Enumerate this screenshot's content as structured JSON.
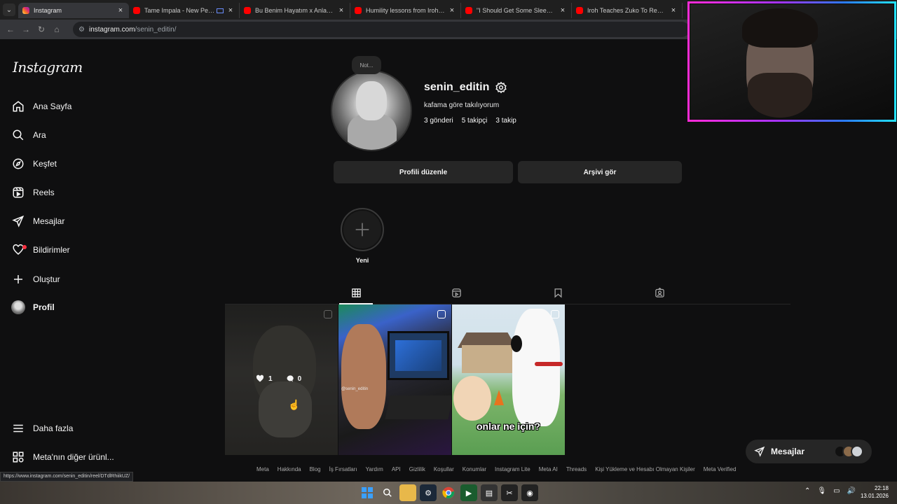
{
  "browser": {
    "tabs": [
      {
        "title": "Instagram",
        "favicon": "instagram-icon",
        "active": true
      },
      {
        "title": "Tame Impala - New Person",
        "favicon": "youtube-icon",
        "active": false
      },
      {
        "title": "Bu Benim Hayatım x Anlamazdı",
        "favicon": "youtube-icon",
        "active": false
      },
      {
        "title": "Humility lessons from Iroh - Yo",
        "favicon": "youtube-icon",
        "active": false
      },
      {
        "title": "\"I Should Get Some Sleep\" Me",
        "favicon": "youtube-icon",
        "active": false
      },
      {
        "title": "Iroh Teaches Zuko To Redirect L",
        "favicon": "youtube-icon",
        "active": false
      }
    ],
    "close_glyph": "×",
    "url_host": "instagram.com",
    "url_path": "/senin_editin/",
    "status_url": "https://www.instagram.com/senin_editin/reel/DTdlRhiikUZ/"
  },
  "sidebar": {
    "logo": "Instagram",
    "items": [
      {
        "label": "Ana Sayfa",
        "icon": "home-icon"
      },
      {
        "label": "Ara",
        "icon": "search-icon"
      },
      {
        "label": "Keşfet",
        "icon": "compass-icon"
      },
      {
        "label": "Reels",
        "icon": "reels-icon"
      },
      {
        "label": "Mesajlar",
        "icon": "messenger-icon"
      },
      {
        "label": "Bildirimler",
        "icon": "heart-icon"
      },
      {
        "label": "Oluştur",
        "icon": "plus-icon"
      },
      {
        "label": "Profil",
        "icon": "avatar"
      }
    ],
    "more": "Daha fazla",
    "meta_products": "Meta'nın diğer ürünl..."
  },
  "profile": {
    "note": "Not...",
    "username": "senin_editin",
    "bio": "kafama göre takılıyorum",
    "stats": {
      "posts": "3 gönderi",
      "followers": "5 takipçi",
      "following": "3 takip"
    },
    "edit_button": "Profili düzenle",
    "archive_button": "Arşivi gör",
    "highlight_new": "Yeni"
  },
  "posts": [
    {
      "likes": "1",
      "comments": "0"
    },
    {
      "watermark": "@senin_editin"
    },
    {
      "caption": "onlar ne için?"
    }
  ],
  "messages_pill": "Mesajlar",
  "footer": [
    "Meta",
    "Hakkında",
    "Blog",
    "İş Fırsatları",
    "Yardım",
    "API",
    "Gizlilik",
    "Koşullar",
    "Konumlar",
    "Instagram Lite",
    "Meta AI",
    "Threads",
    "Kişi Yükleme ve Hesabı Olmayan Kişiler",
    "Meta Verified"
  ],
  "taskbar": {
    "time": "22:18",
    "date": "13.01.2026"
  },
  "colors": {
    "page_bg": "#0f0f10",
    "button_bg": "#262626",
    "notification_dot": "#ff3040"
  }
}
